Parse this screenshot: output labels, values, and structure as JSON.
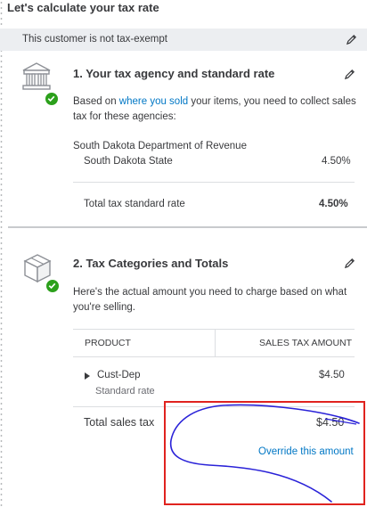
{
  "page_title": "Let's calculate your tax rate",
  "banner": {
    "text": "This customer is not tax-exempt",
    "edit_icon": "pencil-icon"
  },
  "section1": {
    "number_title": "1. Your tax agency and standard rate",
    "icon": "building-icon",
    "desc_before": "Based on ",
    "desc_link": "where you sold",
    "desc_after_line1": " your items, you need to collect sales",
    "desc_line2": "tax for these agencies:",
    "agency_name": "South Dakota Department of Revenue",
    "agency_sub": "South Dakota State",
    "agency_rate": "4.50%",
    "total_label": "Total tax standard rate",
    "total_value": "4.50%"
  },
  "section2": {
    "number_title": "2. Tax Categories and Totals",
    "icon": "box-icon",
    "desc_line1": "Here's the actual amount you need to charge based on what",
    "desc_line2": "you're selling.",
    "col_product": "PRODUCT",
    "col_amount": "SALES TAX AMOUNT",
    "row_product": "Cust-Dep",
    "row_sub": "Standard rate",
    "row_amount": "$4.50",
    "total_label": "Total sales tax",
    "total_value": "$4.50",
    "override_link": "Override this amount"
  },
  "colors": {
    "accent_link": "#0077c5",
    "check_green": "#2ca01c",
    "annotation_red": "#e0231f",
    "annotation_blue": "#2a22d8"
  }
}
